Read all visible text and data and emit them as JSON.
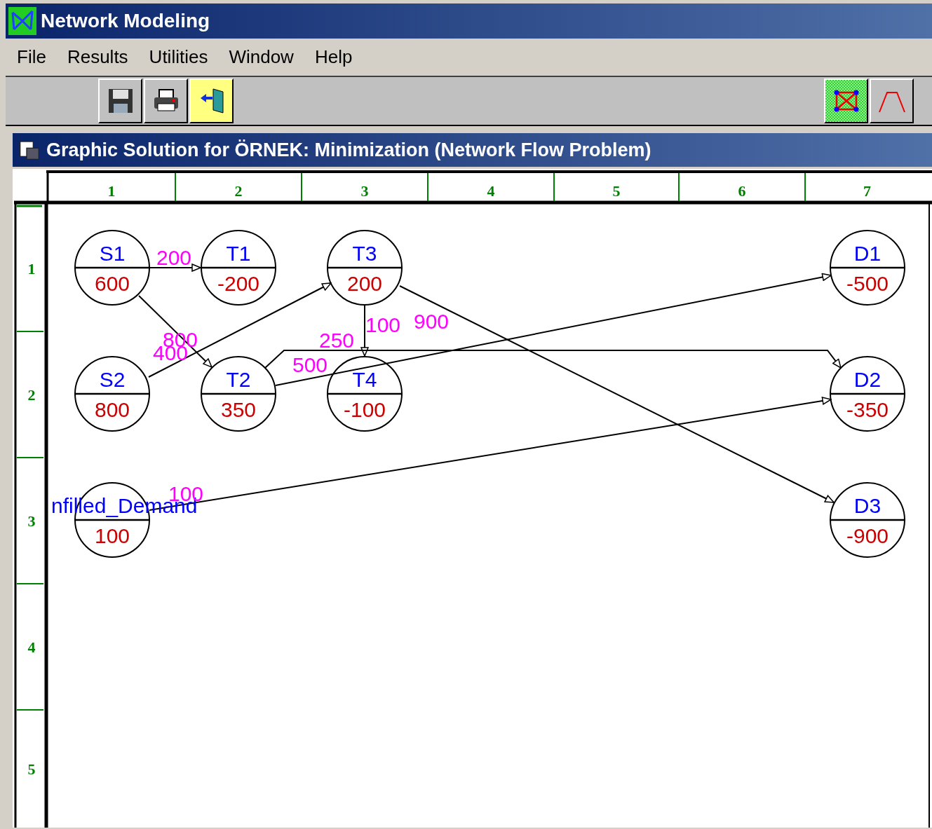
{
  "window": {
    "title": "Network Modeling"
  },
  "menu": [
    "File",
    "Results",
    "Utilities",
    "Window",
    "Help"
  ],
  "toolbar": {
    "left": [
      {
        "kind": "save"
      },
      {
        "kind": "print"
      },
      {
        "kind": "exit"
      }
    ],
    "right": [
      {
        "kind": "network"
      },
      {
        "kind": "chart"
      }
    ]
  },
  "child_window": {
    "title": "Graphic Solution for ÖRNEK: Minimization (Network Flow Problem)"
  },
  "grid": {
    "columns": [
      "1",
      "2",
      "3",
      "4",
      "5",
      "6",
      "7"
    ],
    "rows": [
      "1",
      "2",
      "3",
      "4",
      "5"
    ]
  },
  "nodes": [
    {
      "name": "S1",
      "value": "600"
    },
    {
      "name": "T1",
      "value": "-200"
    },
    {
      "name": "T3",
      "value": "200"
    },
    {
      "name": "D1",
      "value": "-500"
    },
    {
      "name": "S2",
      "value": "800"
    },
    {
      "name": "T2",
      "value": "350"
    },
    {
      "name": "T4",
      "value": "-100"
    },
    {
      "name": "D2",
      "value": "-350"
    },
    {
      "name": "nfilled_Demand",
      "value": "100"
    },
    {
      "name": "D3",
      "value": "-900"
    }
  ],
  "arcs": [
    {
      "flow": "200"
    },
    {
      "flow": "800"
    },
    {
      "flow": "400"
    },
    {
      "flow": "100"
    },
    {
      "flow": "900"
    },
    {
      "flow": "250"
    },
    {
      "flow": "500"
    },
    {
      "flow": "100"
    }
  ]
}
